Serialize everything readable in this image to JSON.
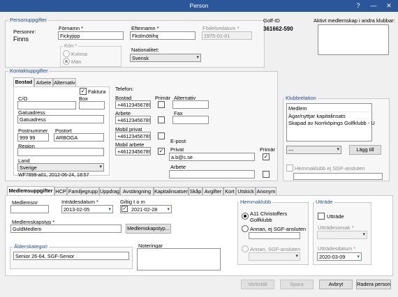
{
  "window": {
    "title": "Person",
    "help_glyph": "?",
    "min_glyph": "—",
    "close_glyph": "✕"
  },
  "personuppgifter": {
    "group_title": "Personuppgifter",
    "personnr_label": "Personnr:",
    "personnr_value": "Finns",
    "fornamn_label": "Förnamn *",
    "fornamn_value": "Fickyjipp",
    "efternamn_label": "Efternamn *",
    "efternamn_value": "Fkolmöttihq",
    "fodelsedatum_label": "Födelsedatum *",
    "fodelsedatum_value": "1975-01-01",
    "kon_title": "Kön *",
    "kon_options": [
      "Kvinna",
      "Man"
    ],
    "kon_selected": "Man",
    "nationalitet_label": "Nationalitet:",
    "nationalitet_value": "Svensk"
  },
  "golf": {
    "id_label": "Golf-ID",
    "id_value": "361662-590",
    "aktivt_label": "Aktivt medlemskap i andra klubbar:"
  },
  "kontakt": {
    "group_title": "Kontaktuppgifter",
    "tabs": [
      "Bostad",
      "Arbete",
      "Alternativ"
    ],
    "active_tab": "Bostad",
    "faktura_label": "Faktura",
    "co_label": "C/O",
    "box_label": "Box",
    "gatuadress_label": "Gatuadress",
    "gatuadress_value": "Gatuadress",
    "postnummer_label": "Postnummer",
    "postnummer_value": "999 99",
    "postort_label": "Postort",
    "postort_value": "ARBOGA",
    "region_label": "Region",
    "land_label": "Land",
    "land_value": "Sverige",
    "changed_info": "WF7899-a01, 2012-06-24, 18:57",
    "telefon_label": "Telefon:",
    "bostad_label": "Bostad",
    "bostad_value": "+46123456789",
    "primar_label": "Primär",
    "alternativ_label": "Alternativ",
    "arbete_label": "Arbete",
    "arbete_value": "+46123456789",
    "fax_label": "Fax",
    "mobil_privat_label": "Mobil privat",
    "mobil_privat_value": "+46123456789",
    "mobil_arbete_label": "Mobil arbete",
    "mobil_arbete_value": "+46123456789",
    "epost_label": "E-post:",
    "privat_label": "Privat",
    "privat_value": "a.b@c.se",
    "epost_primar_label": "Primär",
    "epost_arbete_label": "Arbete"
  },
  "klubbrelation": {
    "group_title": "Klubbrelation",
    "items": [
      "Medlem",
      "Ägar/nyttjar kapitalinsats",
      "Skapad av Norrköpings Golfklubb - U"
    ],
    "select_value": "---",
    "lagg_till": "Lägg till",
    "hemmaklubb_label": "Hemmaklubb ej SGF-ansluten"
  },
  "bottom_tabs": {
    "items": [
      "Medlemsuppgifter",
      "HCP",
      "Familjegrupp",
      "Uppdrag",
      "Avstängning",
      "Kapitalinsatser",
      "Skåp",
      "Avgifter",
      "Kort",
      "Utskick",
      "Anonym"
    ],
    "active": "Medlemsuppgifter"
  },
  "medlem": {
    "medlemsnr_label": "Medlemsnr",
    "intradesdatum_label": "Inträdesdatum *",
    "intradesdatum_value": "2013-02-05",
    "giltig_label": "Giltig t o m",
    "giltig_value": "2021-02-28",
    "medlemskapstyp_label": "Medlemskapstyp *",
    "medlemskapstyp_value": "GuldMedlem",
    "medlemskapstyp_button": "Medlemskapstyp...",
    "alderskategori_title": "Ålderskategori",
    "alderskategori_value": "Senior 26-64, SGF-Senior",
    "noteringar_label": "Noteringar"
  },
  "hemmaklubb": {
    "group_title": "Hemmaklubb",
    "option1_label": "A11 Christoffers Golfklubb",
    "option2_label": "Annan, ej SGF-ansluten",
    "option3_label": "Annan, SGF-ansluten"
  },
  "uttrade": {
    "group_title": "Utträde",
    "checkbox_label": "Utträde",
    "orsak_label": "Utträdesorsak *",
    "datum_label": "Utträdesdatum *",
    "datum_value": "2020-03-09"
  },
  "footer": {
    "verkstall": "Verkställ",
    "spara": "Spara",
    "avbryt": "Avbryt",
    "radera": "Radera person"
  }
}
